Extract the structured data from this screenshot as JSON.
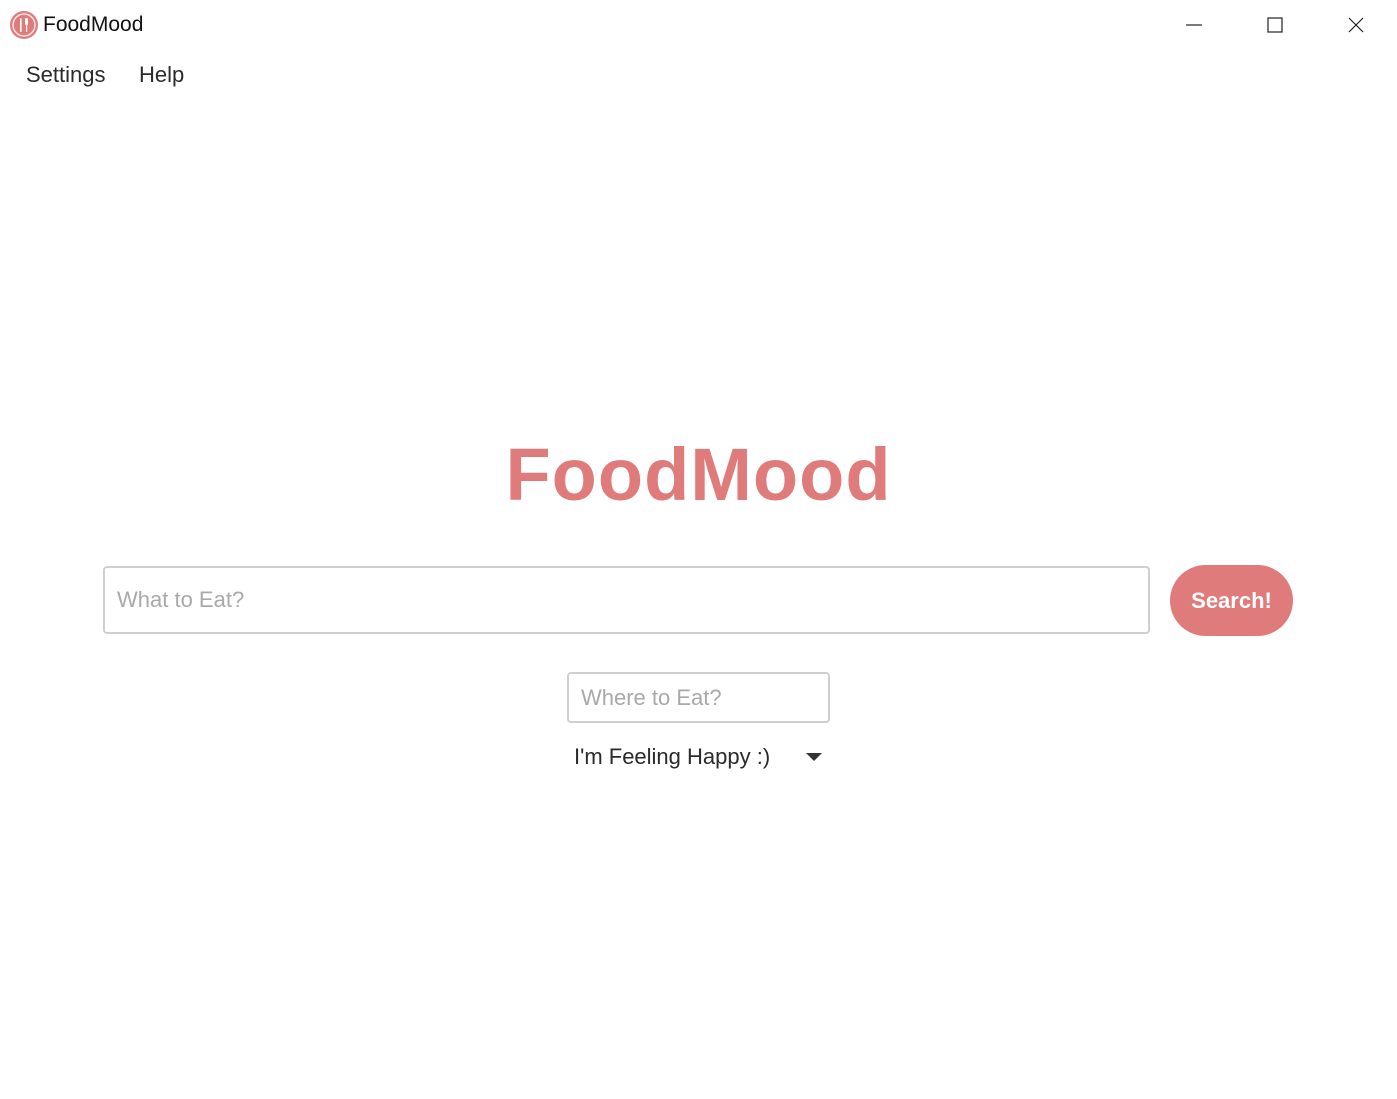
{
  "window": {
    "title": "FoodMood",
    "icon": "app-logo-icon",
    "controls": [
      "minimize-icon",
      "maximize-icon",
      "close-icon"
    ]
  },
  "menu": {
    "items": [
      {
        "label": "Settings"
      },
      {
        "label": "Help"
      }
    ]
  },
  "main": {
    "brand_title": "FoodMood",
    "what_placeholder": "What to Eat?",
    "what_value": "",
    "search_label": "Search!",
    "where_placeholder": "Where to Eat?",
    "where_value": "",
    "mood_selected": "I'm Feeling Happy :)"
  },
  "colors": {
    "accent": "#e07b7b",
    "text": "#2b2b2b",
    "placeholder": "#a9a9a9",
    "input_border": "#cfcfcf"
  }
}
